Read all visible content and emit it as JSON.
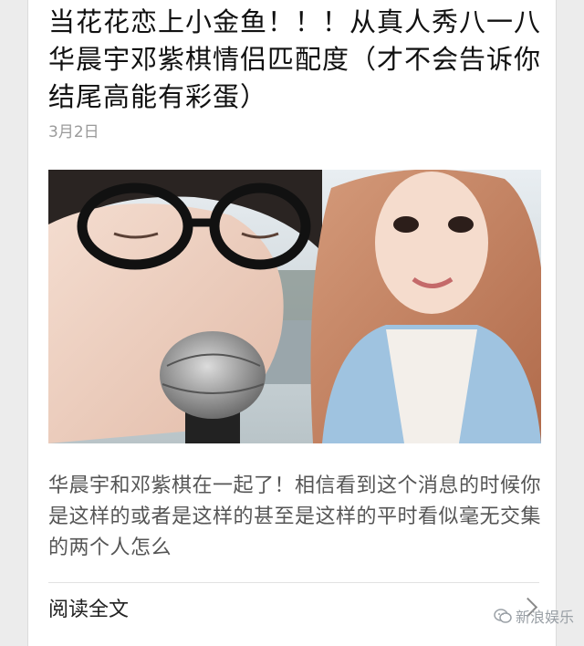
{
  "article": {
    "title": "当花花恋上小金鱼！！！从真人秀八一八华晨宇邓紫棋情侣匹配度（才不会告诉你结尾高能有彩蛋）",
    "date": "3月2日",
    "cover_image_icon": "photo-couple",
    "summary": "华晨宇和邓紫棋在一起了！相信看到这个消息的时候你是这样的或者是这样的甚至是这样的平时看似毫无交集的两个人怎么",
    "read_more": "阅读全文",
    "read_more_icon": "chevron-right-icon"
  },
  "watermark": {
    "icon": "wechat-icon",
    "text": "新浪娱乐"
  },
  "colors": {
    "background": "#ececec",
    "card": "#ffffff",
    "title": "#111111",
    "meta": "#9a9a9a",
    "summary": "#555555"
  }
}
